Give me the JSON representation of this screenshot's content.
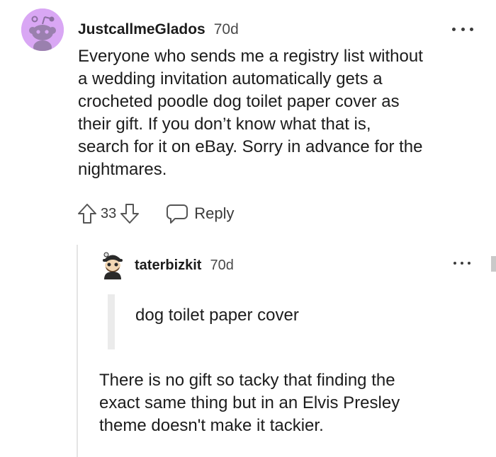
{
  "comment": {
    "username": "JustcallmeGlados",
    "age": "70d",
    "body_lines": [
      "Everyone who sends me a registry list without",
      "a wedding invitation automatically gets a",
      "crocheted poodle dog toilet paper cover as",
      "their gift. If you don’t know what that is,",
      "search for it on eBay. Sorry in advance for the",
      "nightmares."
    ],
    "score": "33",
    "reply_label": "Reply",
    "avatar_color": "#d9a7f4"
  },
  "reply": {
    "username": "taterbizkit",
    "age": "70d",
    "quote": "dog toilet paper cover",
    "body_lines": [
      "There is no gift so tacky that finding the",
      "exact same thing but in an Elvis Presley",
      "theme doesn't make it tackier."
    ]
  },
  "icons": {
    "upvote": "upvote-arrow-icon",
    "downvote": "downvote-arrow-icon",
    "reply": "speech-bubble-icon",
    "more": "ellipsis-icon"
  }
}
